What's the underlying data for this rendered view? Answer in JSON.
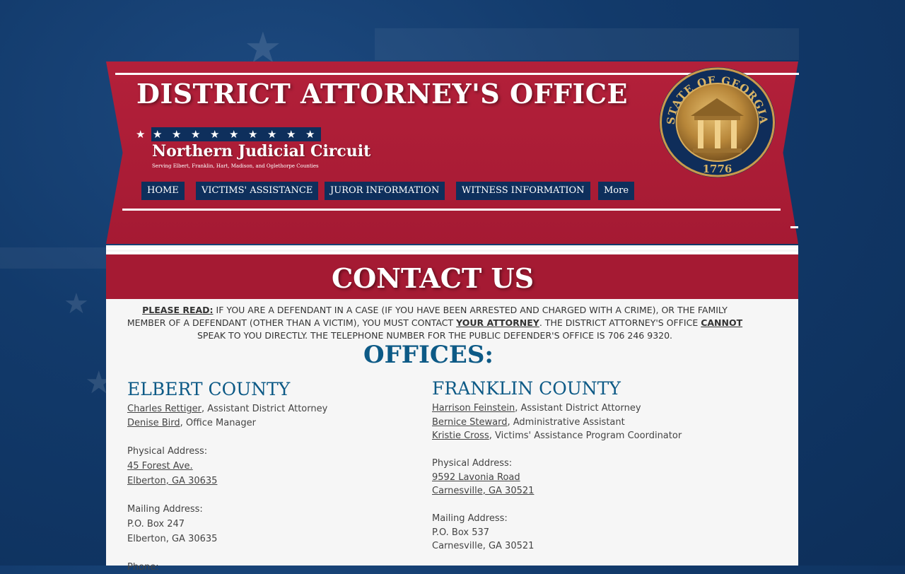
{
  "header": {
    "title": "DISTRICT ATTORNEY'S OFFICE",
    "subtitle": "Northern Judicial Circuit",
    "tagline": "Serving Elbert, Franklin, Hart, Madison, and Oglethorpe Counties",
    "seal": {
      "top_text": "STATE OF GEORGIA",
      "year": "1776"
    }
  },
  "nav": {
    "items": [
      {
        "label": "HOME"
      },
      {
        "label": "VICTIMS' ASSISTANCE"
      },
      {
        "label": "JUROR INFORMATION"
      },
      {
        "label": "WITNESS INFORMATION"
      },
      {
        "label": "More"
      }
    ]
  },
  "page": {
    "heading": "CONTACT US",
    "notice": {
      "please_read": "PLEASE READ:",
      "part1": " IF YOU ARE A DEFENDANT IN A CASE (IF YOU HAVE BEEN ARRESTED AND CHARGED WITH A CRIME), OR THE FAMILY MEMBER OF A DEFENDANT (OTHER THAN A VICTIM), YOU MUST CONTACT ",
      "your_attorney": "YOUR ATTORNEY",
      "part2": ".  THE DISTRICT ATTORNEY'S OFFICE ",
      "cannot": "CANNOT",
      "part3": " SPEAK TO YOU DIRECTLY.  THE TELEPHONE NUMBER FOR THE PUBLIC DEFENDER'S OFFICE IS 706 246 9320."
    },
    "offices_heading": "OFFICES:"
  },
  "offices": {
    "elbert": {
      "name": "ELBERT COUNTY",
      "staff": [
        {
          "name": "Charles Rettiger",
          "role": ", Assistant District Attorney"
        },
        {
          "name": "Denise Bird",
          "role": ", Office Manager"
        }
      ],
      "physical_label": "Physical Address:",
      "physical_line1": "45 Forest Ave.",
      "physical_line2": "Elberton, GA 30635",
      "mailing_label": "Mailing Address:",
      "mailing_line1": "P.O. Box 247",
      "mailing_line2": "Elberton, GA 30635",
      "phone_label": "Phone:"
    },
    "franklin": {
      "name": "FRANKLIN COUNTY",
      "staff": [
        {
          "name": "Harrison Feinstein",
          "role": ", Assistant District Attorney"
        },
        {
          "name": "Bernice Steward",
          "role": ", Administrative Assistant"
        },
        {
          "name": "Kristie Cross",
          "role": ", Victims' Assistance Program Coordinator"
        }
      ],
      "physical_label": "Physical Address:",
      "physical_line1": "9592 Lavonia Road",
      "physical_line2": "Carnesville, GA 30521",
      "mailing_label": "Mailing Address:",
      "mailing_line1": "P.O. Box 537",
      "mailing_line2": "Carnesville, GA 30521"
    }
  },
  "colors": {
    "banner_red": "#a51a33",
    "navy": "#0e2f5c",
    "heading_blue": "#0d5a86"
  }
}
